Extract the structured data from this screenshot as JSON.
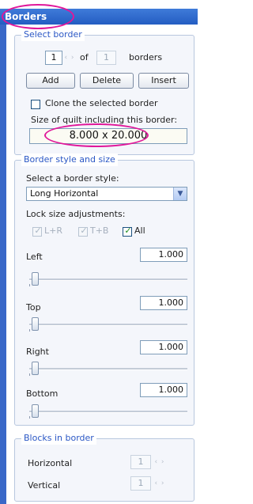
{
  "panel": {
    "title": "Borders"
  },
  "select_border": {
    "legend": "Select border",
    "current": "1",
    "of_label": "of",
    "total": "1",
    "unit_label": "borders",
    "add_label": "Add",
    "delete_label": "Delete",
    "insert_label": "Insert",
    "clone_label": "Clone the selected border",
    "clone_checked": false,
    "size_label": "Size of quilt including this border:",
    "size_value": "8.000 x 20.000"
  },
  "border_style": {
    "legend": "Border style and size",
    "style_label": "Select a border style:",
    "style_value": "Long Horizontal",
    "lock_label": "Lock size adjustments:",
    "lock_lr_label": "L+R",
    "lock_tb_label": "T+B",
    "lock_all_label": "All",
    "lock_lr_checked": true,
    "lock_tb_checked": true,
    "lock_all_checked": true,
    "left_label": "Left",
    "left_value": "1.000",
    "top_label": "Top",
    "top_value": "1.000",
    "right_label": "Right",
    "right_value": "1.000",
    "bottom_label": "Bottom",
    "bottom_value": "1.000"
  },
  "blocks": {
    "legend": "Blocks in border",
    "horizontal_label": "Horizontal",
    "horizontal_value": "1",
    "vertical_label": "Vertical",
    "vertical_value": "1"
  },
  "colors": {
    "title_bar": "#245dc2",
    "legend_text": "#2a57c5",
    "annotation": "#e0179a"
  },
  "icons": {
    "spin": "spin-arrows-icon",
    "dropdown": "chevron-down-icon",
    "check": "checkmark-icon"
  }
}
